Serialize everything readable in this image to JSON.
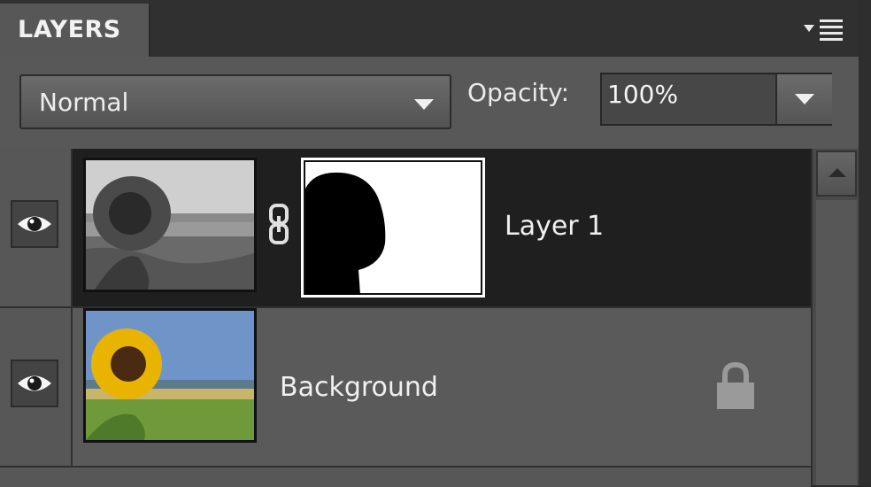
{
  "panel": {
    "tab_title": "LAYERS",
    "menu_icon": "panel-menu-icon"
  },
  "controls": {
    "blend_mode": "Normal",
    "opacity_label": "Opacity:",
    "opacity_value": "100%"
  },
  "layers": [
    {
      "name": "Layer 1",
      "visible": true,
      "selected": true,
      "has_mask": true,
      "locked": false,
      "thumbnail": "grayscale-sunflower-landscape",
      "mask_thumbnail": "black-silhouette-on-white"
    },
    {
      "name": "Background",
      "visible": true,
      "selected": false,
      "has_mask": false,
      "locked": true,
      "thumbnail": "color-sunflower-landscape"
    }
  ],
  "icons": {
    "visibility": "eye-icon",
    "link": "chain-link-icon",
    "lock": "lock-icon",
    "scroll_up": "scroll-up-arrow-icon"
  },
  "colors": {
    "panel_bg": "#585858",
    "header_bg": "#303030",
    "selected_row_bg": "#1f1f1f",
    "text": "#f0f0f0"
  }
}
